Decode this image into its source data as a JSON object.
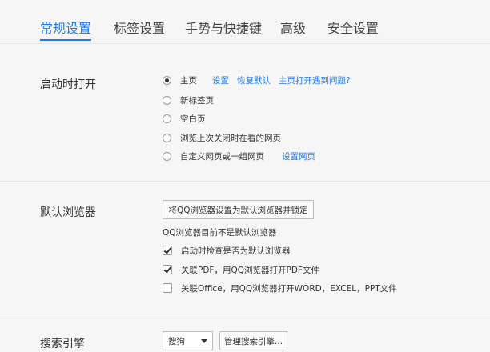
{
  "tabs": [
    {
      "label": "常规设置",
      "active": true
    },
    {
      "label": "标签设置",
      "active": false
    },
    {
      "label": "手势与快捷键",
      "active": false
    },
    {
      "label": "高级",
      "active": false
    },
    {
      "label": "安全设置",
      "active": false
    }
  ],
  "startup": {
    "label": "启动时打开",
    "options": [
      {
        "label": "主页",
        "checked": true
      },
      {
        "label": "新标签页",
        "checked": false
      },
      {
        "label": "空白页",
        "checked": false
      },
      {
        "label": "浏览上次关闭时在看的网页",
        "checked": false
      },
      {
        "label": "自定义网页或一组网页",
        "checked": false
      }
    ],
    "home_links": {
      "settings": "设置",
      "restore_default": "恢复默认",
      "home_problem": "主页打开遇到问题?"
    },
    "custom_link": "设置网页"
  },
  "default_browser": {
    "label": "默认浏览器",
    "button": "将QQ浏览器设置为默认浏览器并锁定",
    "status": "QQ浏览器目前不是默认浏览器",
    "checks": [
      {
        "label": "启动时检查是否为默认浏览器",
        "checked": true
      },
      {
        "label": "关联PDF，用QQ浏览器打开PDF文件",
        "checked": true
      },
      {
        "label": "关联Office，用QQ浏览器打开WORD，EXCEL，PPT文件",
        "checked": false
      }
    ]
  },
  "search": {
    "label": "搜索引擎",
    "selected": "搜狗",
    "manage_button": "管理搜索引擎..."
  },
  "colors": {
    "accent": "#1e7be8",
    "background": "#f6f6f6"
  }
}
